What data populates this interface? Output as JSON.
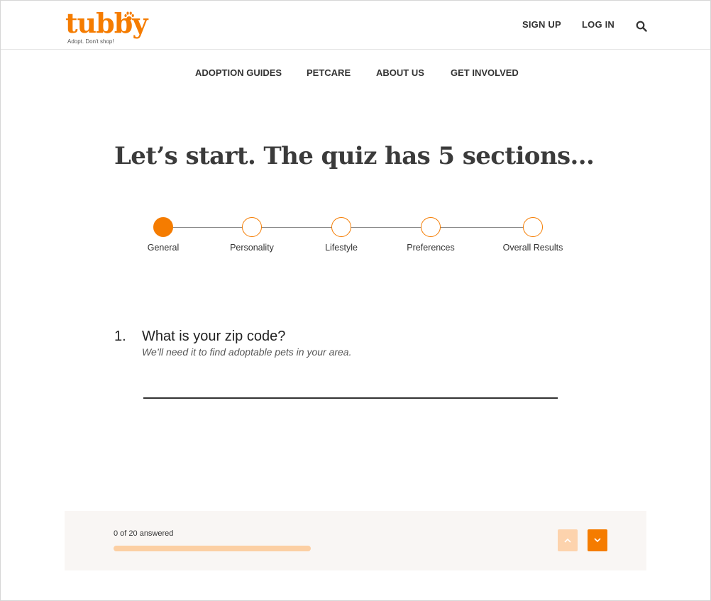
{
  "brand": {
    "name": "tubby",
    "tagline": "Adopt. Don't shop!",
    "accent_color": "#f57c00",
    "accent_light_color": "#fdd3ad"
  },
  "header": {
    "signup_label": "SIGN UP",
    "login_label": "LOG IN",
    "search_icon": "search-icon"
  },
  "main_nav": {
    "items": [
      "ADOPTION GUIDES",
      "PETCARE",
      "ABOUT US",
      "GET INVOLVED"
    ]
  },
  "quiz": {
    "title": "Let’s start. The quiz has 5 sections...",
    "steps": [
      {
        "label": "General",
        "active": true
      },
      {
        "label": "Personality",
        "active": false
      },
      {
        "label": "Lifestyle",
        "active": false
      },
      {
        "label": "Preferences",
        "active": false
      },
      {
        "label": "Overall Results",
        "active": false
      }
    ],
    "question": {
      "number": "1.",
      "text": "What is your zip code?",
      "hint": "We’ll need it to find adoptable pets in your area.",
      "value": "",
      "placeholder": ""
    }
  },
  "progress": {
    "text": "0 of 20 answered",
    "answered": 0,
    "total": 20,
    "fraction": 0,
    "up_icon": "chevron-up-icon",
    "down_icon": "chevron-down-icon"
  }
}
